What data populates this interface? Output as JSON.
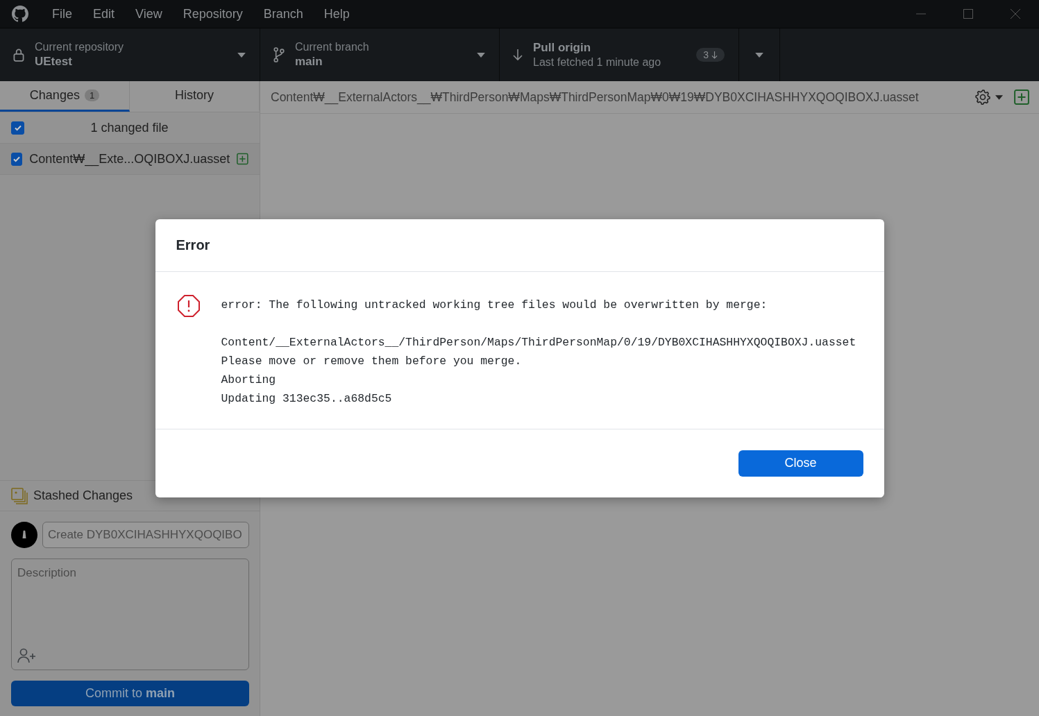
{
  "menu": [
    "File",
    "Edit",
    "View",
    "Repository",
    "Branch",
    "Help"
  ],
  "toolbar": {
    "repository": {
      "label": "Current repository",
      "value": "UEtest"
    },
    "branch": {
      "label": "Current branch",
      "value": "main"
    },
    "pull": {
      "title": "Pull origin",
      "subtitle": "Last fetched 1 minute ago",
      "badge": "3"
    }
  },
  "tabs": [
    {
      "label": "Changes",
      "count": "1",
      "selected": true
    },
    {
      "label": "History",
      "selected": false
    }
  ],
  "changes": {
    "all_checked": true,
    "summary": "1 changed file",
    "files": [
      {
        "path": "Content₩__Exte...OQIBOXJ.uasset",
        "checked": true,
        "kind": "added"
      }
    ]
  },
  "stash": {
    "label": "Stashed Changes"
  },
  "commit": {
    "summary_placeholder": "Create DYB0XCIHASHHYXQOQIBO",
    "description_placeholder": "Description",
    "button": "Commit to **main**"
  },
  "diff": {
    "path": "Content₩__ExternalActors__₩ThirdPerson₩Maps₩ThirdPersonMap₩0₩19₩DYB0XCIHASHHYXQOQIBOXJ.uasset"
  },
  "dialog": {
    "title": "Error",
    "message": [
      "error: The following untracked working tree files would be overwritten by merge:",
      "Content/__ExternalActors__/ThirdPerson/Maps/ThirdPersonMap/0/19/DYB0XCIHASHHYXQOQIBOXJ.uasset\nPlease move or remove them before you merge.\nAborting\nUpdating 313ec35..a68d5c5"
    ],
    "button": "Close"
  }
}
